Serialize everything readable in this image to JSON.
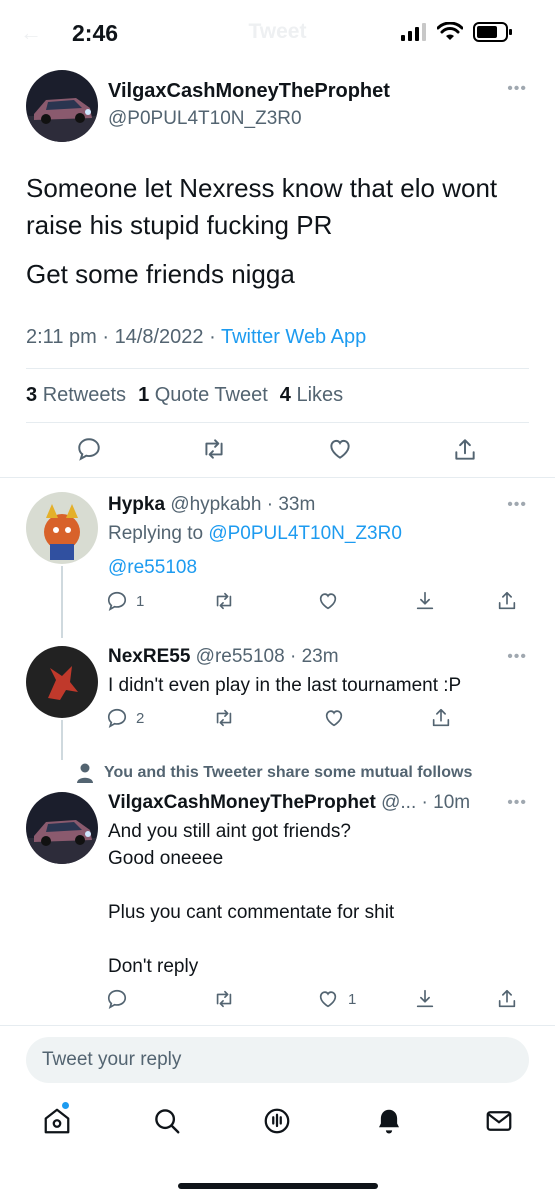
{
  "status_bar": {
    "time": "2:46",
    "header_title": "Tweet"
  },
  "main_tweet": {
    "display_name": "VilgaxCashMoneyTheProphet",
    "handle": "@P0PUL4T10N_Z3R0",
    "text_line1": "Someone let Nexress know that elo wont raise his stupid fucking PR",
    "text_line2": "Get some friends nigga",
    "time": "2:11 pm",
    "date": "14/8/2022",
    "source": "Twitter Web App",
    "retweets_count": "3",
    "retweets_label": "Retweets",
    "quotes_count": "1",
    "quotes_label": "Quote Tweet",
    "likes_count": "4",
    "likes_label": "Likes"
  },
  "replies": [
    {
      "display_name": "Hypka",
      "handle": "@hypkabh",
      "age": "33m",
      "replying_prefix": "Replying to",
      "replying_to": "@P0PUL4T10N_Z3R0",
      "text": "@re55108",
      "reply_count": "1",
      "like_count": ""
    },
    {
      "display_name": "NexRE55",
      "handle": "@re55108",
      "age": "23m",
      "text": "I didn't even play in the last tournament :P",
      "reply_count": "2",
      "like_count": ""
    },
    {
      "display_name": "VilgaxCashMoneyTheProphet",
      "handle": "@...",
      "age": "10m",
      "text_lines": [
        "And you still aint got friends?",
        "Good oneeee",
        "",
        "Plus you cant commentate for shit",
        "",
        "Don't reply"
      ],
      "reply_count": "",
      "like_count": "1"
    }
  ],
  "mutual_notice": "You and this Tweeter share some mutual follows",
  "compose_placeholder": "Tweet your reply",
  "colors": {
    "accent": "#1d9bf0",
    "text": "#0f1419",
    "secondary": "#536471",
    "divider": "#e6ecf0"
  },
  "icons": [
    "reply-icon",
    "retweet-icon",
    "like-icon",
    "share-icon",
    "download-icon",
    "home-icon",
    "search-icon",
    "spaces-icon",
    "notifications-icon",
    "messages-icon"
  ]
}
